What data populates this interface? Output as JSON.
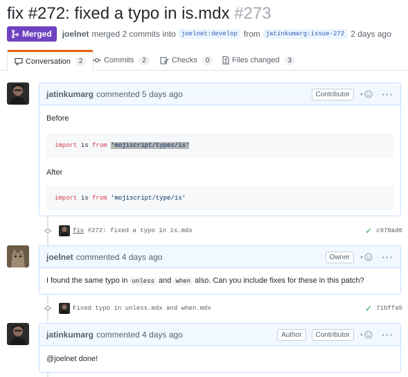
{
  "pr": {
    "title": "fix #272: fixed a typo in is.mdx",
    "number": "#273",
    "state": "Merged",
    "author": "joelnet",
    "merge_text": "merged 2 commits into",
    "base_branch": "joelnet:develop",
    "from_text": "from",
    "head_branch": "jatinkumarg:issue-272",
    "time": "2 days ago"
  },
  "tabs": [
    {
      "label": "Conversation",
      "count": "2",
      "icon": "comment-icon"
    },
    {
      "label": "Commits",
      "count": "2",
      "icon": "commit-icon"
    },
    {
      "label": "Checks",
      "count": "0",
      "icon": "checklist-icon"
    },
    {
      "label": "Files changed",
      "count": "3",
      "icon": "file-diff-icon"
    }
  ],
  "timeline": {
    "comment1": {
      "author": "jatinkumarg",
      "action": "commented 5 days ago",
      "label": "Contributor",
      "before_text": "Before",
      "code1": {
        "import": "import",
        "is": "is",
        "from": "from",
        "path": "'mojiscript/types/is'"
      },
      "after_text": "After",
      "code2": {
        "import": "import",
        "is": "is",
        "from": "from",
        "path": "'mojiscript/type/is'"
      }
    },
    "commit1": {
      "prefix": "fix",
      "message": " #272: fixed a typo in is.mdx",
      "sha": "c970ad6"
    },
    "comment2": {
      "author": "joelnet",
      "action": "commented 4 days ago",
      "label": "Owner",
      "text1": "I found the same typo in",
      "code_a": "unless",
      "text2": "and",
      "code_b": "when",
      "text3": "also. Can you include fixes for these in this patch?"
    },
    "commit2": {
      "message": "Fixed typo in unless.mdx and when.mdx",
      "sha": "71bffa5"
    },
    "comment3": {
      "author": "jatinkumarg",
      "action": "commented 4 days ago",
      "label1": "Author",
      "label2": "Contributor",
      "text": "@joelnet done!"
    }
  },
  "icons": {
    "reaction": "smiley-icon",
    "menu": "kebab-horizontal-icon",
    "check": "check-icon",
    "merge": "git-merge-icon",
    "commit_dot": "git-commit-icon"
  },
  "colors": {
    "merged": "#6f42c1",
    "tab_active": "#e36209",
    "comment_border": "#c8e1ff",
    "comment_header": "#f1f8ff",
    "success": "#28a745"
  }
}
